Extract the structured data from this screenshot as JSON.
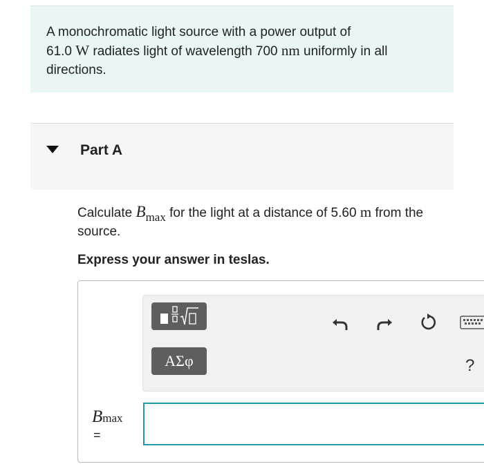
{
  "problem": {
    "line1": "A monochromatic light source with a power output of",
    "power_value": "61.0",
    "power_unit": "W",
    "mid_text": "radiates light of wavelength",
    "wavelength_value": "700",
    "wavelength_unit": "nm",
    "end_text": "uniformly in all directions."
  },
  "part": {
    "title": "Part A",
    "question_pre": "Calculate",
    "var_symbol": "B",
    "var_sub": "max",
    "question_mid": "for the light at a distance of",
    "distance_value": "5.60",
    "distance_unit": "m",
    "question_end": "from the source.",
    "instruction": "Express your answer in teslas."
  },
  "toolbar": {
    "symbols_label": "ΑΣφ",
    "help_label": "?",
    "icons": [
      "templates-icon",
      "undo-icon",
      "redo-icon",
      "reset-icon",
      "keyboard-icon"
    ]
  },
  "answer": {
    "label_symbol": "B",
    "label_sub": "max",
    "label_eq": "=",
    "value": ""
  },
  "colors": {
    "problem_bg": "#e8f6f6",
    "part_header_bg": "#f5f5f5",
    "input_border": "#1f9aa8",
    "tool_button": "#5e5e5e"
  }
}
